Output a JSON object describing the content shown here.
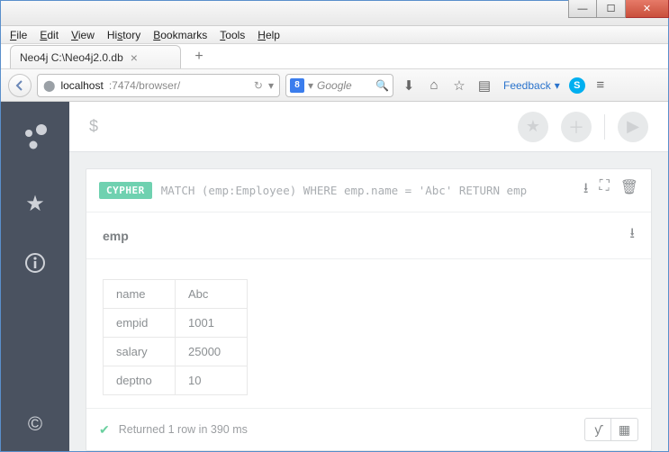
{
  "window": {
    "menus": [
      "File",
      "Edit",
      "View",
      "History",
      "Bookmarks",
      "Tools",
      "Help"
    ]
  },
  "tab": {
    "title": "Neo4j C:\\Neo4j2.0.db"
  },
  "url": {
    "host": "localhost",
    "rest": ":7474/browser/"
  },
  "search": {
    "placeholder": "Google"
  },
  "toolbar": {
    "feedback": "Feedback"
  },
  "editor": {
    "prompt": "$"
  },
  "query": {
    "badge": "CYPHER",
    "text": "MATCH (emp:Employee) WHERE emp.name = 'Abc' RETURN emp"
  },
  "result": {
    "heading": "emp",
    "rows": [
      {
        "key": "name",
        "val": "Abc"
      },
      {
        "key": "empid",
        "val": "1001"
      },
      {
        "key": "salary",
        "val": "25000"
      },
      {
        "key": "deptno",
        "val": "10"
      }
    ],
    "status": "Returned 1 row in 390 ms"
  }
}
